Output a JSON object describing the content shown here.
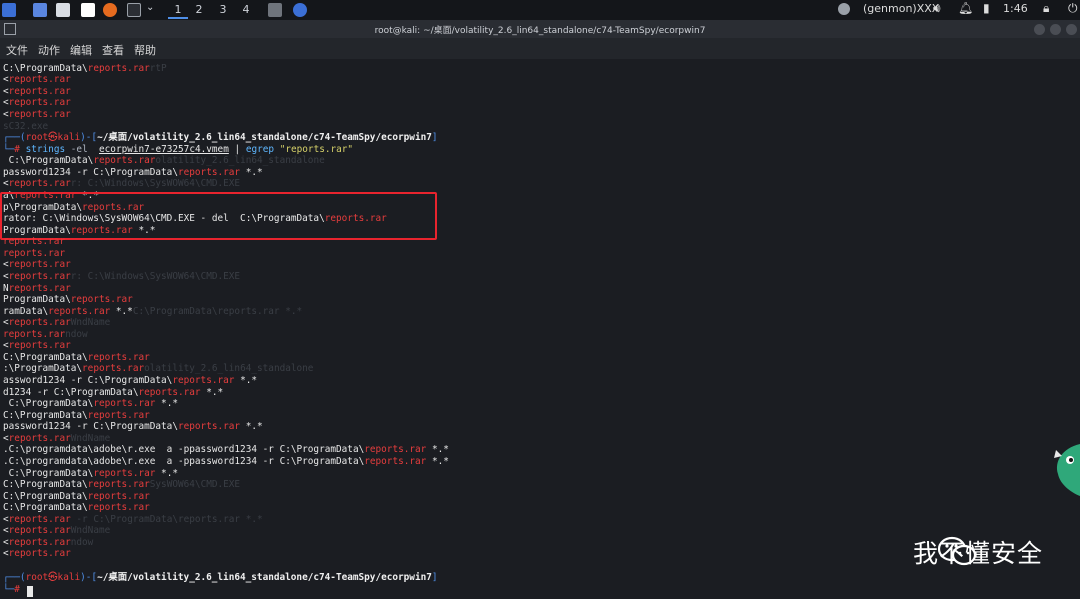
{
  "panel": {
    "workspaces": [
      "1",
      "2",
      "3",
      "4"
    ],
    "genmon": "(genmon)XXX",
    "clock": "1:46"
  },
  "window": {
    "title": "root@kali: ~/桌面/volatility_2.6_lin64_standalone/c74-TeamSpy/ecorpwin7"
  },
  "menu": [
    "文件",
    "动作",
    "编辑",
    "查看",
    "帮助"
  ],
  "terminal": {
    "prompt_user": "root",
    "prompt_host": "kali",
    "prompt_path": "~/桌面/volatility_2.6_lin64_standalone/c74-TeamSpy/ecorpwin7",
    "command": "strings -el  ecorpwin7-e73257c4.vmem | egrep \"reports.rar\"",
    "cmd_strings": "strings",
    "cmd_flag": "-el",
    "cmd_file": "ecorpwin7-e73257c4.vmem",
    "cmd_pipe": "|",
    "cmd_egrep": "egrep",
    "cmd_pattern": "\"reports.rar\"",
    "match": "reports.rar",
    "highlight_lines": [
      "a\\reports.rar *.*",
      "p\\ProgramData\\reports.rar",
      "rator: C:\\Windows\\SysWOW64\\CMD.EXE - del  C:\\ProgramData\\reports.rar",
      "ProgramData\\reports.rar *.*"
    ]
  },
  "watermark": {
    "text": "我不懂安全",
    "icon": "wechat-icon"
  },
  "colors": {
    "match_red": "#e63d3d",
    "highlight_box": "#e8242e",
    "prompt_blue": "#4f8fe8"
  }
}
